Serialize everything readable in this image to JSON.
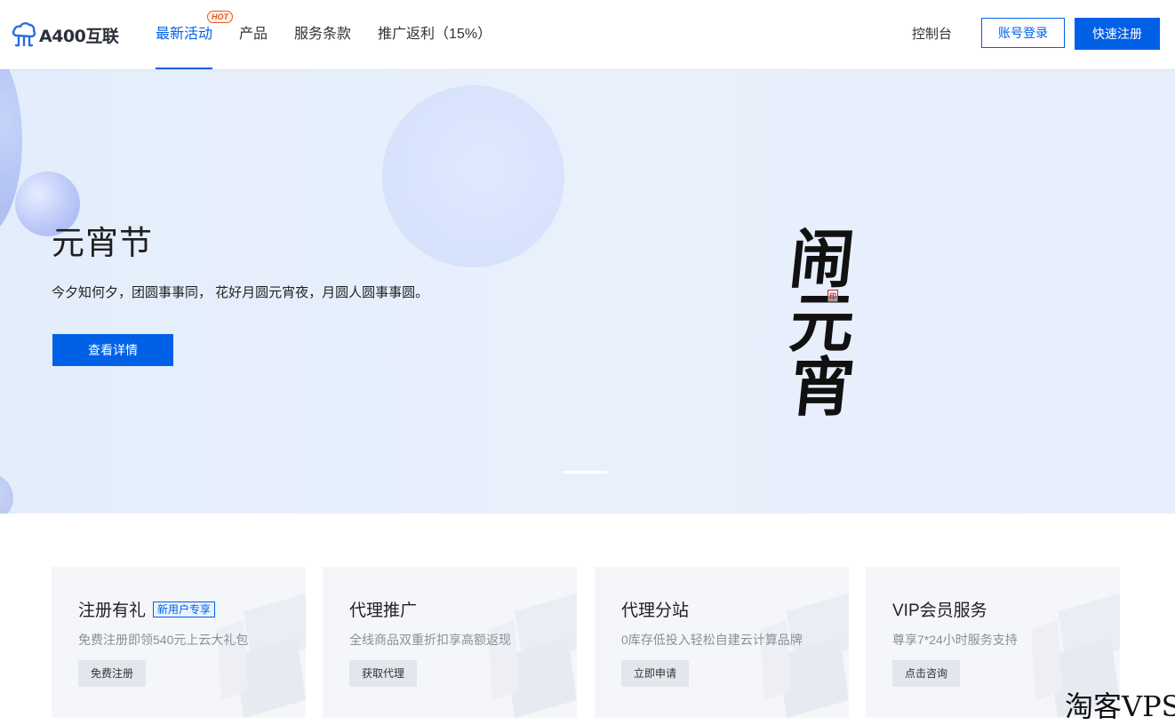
{
  "header": {
    "logo_text": "A400互联",
    "nav": [
      {
        "label": "最新活动",
        "active": true,
        "badge": "HOT"
      },
      {
        "label": "产品",
        "active": false
      },
      {
        "label": "服务条款",
        "active": false
      },
      {
        "label": "推广返利（15%）",
        "active": false
      }
    ],
    "console_label": "控制台",
    "login_label": "账号登录",
    "register_label": "快速注册"
  },
  "banner": {
    "title": "元宵节",
    "subtitle": "今夕知何夕，团圆事事同， 花好月圆元宵夜，月圆人圆事事圆。",
    "button_label": "查看详情",
    "calligraphy": [
      "闹",
      "元",
      "宵"
    ]
  },
  "cards": [
    {
      "title": "注册有礼",
      "tag": "新用户专享",
      "desc": "免费注册即领540元上云大礼包",
      "button": "免费注册"
    },
    {
      "title": "代理推广",
      "tag": "",
      "desc": "全线商品双重折扣享高额返现",
      "button": "获取代理"
    },
    {
      "title": "代理分站",
      "tag": "",
      "desc": "0库存低投入轻松自建云计算品牌",
      "button": "立即申请"
    },
    {
      "title": "VIP会员服务",
      "tag": "",
      "desc": "尊享7*24小时服务支持",
      "button": "点击咨询"
    }
  ],
  "watermark": "淘客VPS",
  "colors": {
    "accent": "#0061e6",
    "hot": "#e05a1c",
    "banner_bg": "#e6eefb"
  }
}
